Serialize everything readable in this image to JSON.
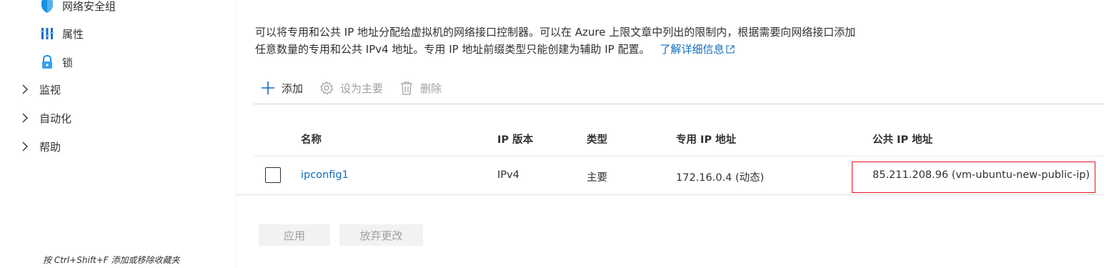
{
  "sidebar": {
    "items": [
      {
        "label": "网络安全组",
        "icon": "shield-icon"
      },
      {
        "label": "属性",
        "icon": "properties-icon"
      },
      {
        "label": "锁",
        "icon": "lock-icon"
      }
    ],
    "groups": [
      {
        "label": "监视"
      },
      {
        "label": "自动化"
      },
      {
        "label": "帮助"
      }
    ]
  },
  "main": {
    "description_line1": "可以将专用和公共 IP 地址分配给虚拟机的网络接口控制器。可以在 Azure 上限文章中列出的限制内，根据需要向网络接口添加",
    "description_line2": "任意数量的专用和公共 IPv4 地址。专用 IP 地址前缀类型只能创建为辅助 IP 配置。",
    "learn_more": "了解详细信息",
    "toolbar": {
      "add": "添加",
      "set_primary": "设为主要",
      "delete": "删除"
    },
    "table": {
      "columns": [
        "名称",
        "IP 版本",
        "类型",
        "专用 IP 地址",
        "公共 IP 地址"
      ],
      "rows": [
        {
          "name": "ipconfig1",
          "ip_version": "IPv4",
          "type": "主要",
          "private_ip": "172.16.0.4 (动态)",
          "public_ip": "85.211.208.96 (vm-ubuntu-new-public-ip)"
        }
      ]
    },
    "buttons": {
      "apply": "应用",
      "discard": "放弃更改"
    }
  },
  "footer_hint": "按 Ctrl+Shift+F 添加或移除收藏夹",
  "colors": {
    "link": "#0f6cbd",
    "highlight": "#e81123",
    "disabled": "#a19f9d"
  }
}
